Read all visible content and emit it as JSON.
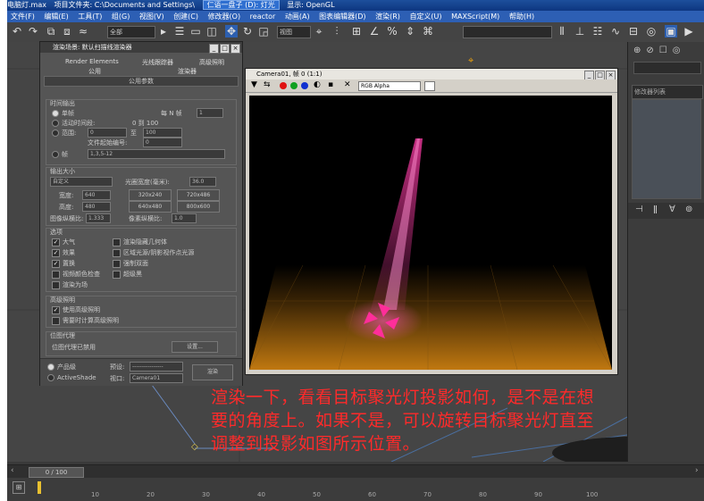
{
  "titlebar": {
    "items": [
      "电脑灯.max",
      "项目文件夹: C:\\Documents and Settings\\",
      "仁语一盘子 (D): 灯光",
      "显示: OpenGL"
    ]
  },
  "menubar": {
    "items": [
      "文件(F)",
      "编辑(E)",
      "工具(T)",
      "组(G)",
      "视图(V)",
      "创建(C)",
      "修改器(O)",
      "reactor",
      "动画(A)",
      "图表编辑器(D)",
      "渲染(R)",
      "自定义(U)",
      "MAXScript(M)",
      "帮助(H)"
    ]
  },
  "toolbar": {
    "selection_filter": "全部",
    "ref_coord": "视图"
  },
  "render_setup": {
    "title": "渲染场景: 默认扫描线渲染器",
    "tabs": [
      "Render Elements",
      "光线跟踪器",
      "高级照明",
      "公用",
      "渲染器"
    ],
    "rollout": "公用参数",
    "time_output": {
      "label": "时间输出",
      "single": "单帧",
      "every_n_label": "每 N 帧",
      "every_n_value": "1",
      "active_segment": "活动时间段:",
      "active_range": "0 到 100",
      "range": "范围:",
      "range_from": "0",
      "range_to_label": "至",
      "range_to": "100",
      "file_number_base": "文件起始编号:",
      "file_number_value": "0",
      "frames": "帧",
      "frames_value": "1,3,5-12"
    },
    "output_size": {
      "label": "输出大小",
      "preset": "自定义",
      "aperture_label": "光圈宽度(毫米):",
      "aperture_value": "36.0",
      "width_label": "宽度:",
      "width_value": "640",
      "height_label": "高度:",
      "height_value": "480",
      "presets": [
        "320x240",
        "720x486",
        "640x480",
        "800x600"
      ],
      "image_aspect_label": "图像纵横比:",
      "image_aspect_value": "1.333",
      "pixel_aspect_label": "像素纵横比:",
      "pixel_aspect_value": "1.0"
    },
    "options": {
      "label": "选项",
      "items": [
        {
          "label": "大气",
          "checked": true
        },
        {
          "label": "渲染隐藏几何体",
          "checked": false
        },
        {
          "label": "效果",
          "checked": true
        },
        {
          "label": "区域光源/阴影视作点光源",
          "checked": false
        },
        {
          "label": "置换",
          "checked": true
        },
        {
          "label": "强制双面",
          "checked": false
        },
        {
          "label": "视频颜色检查",
          "checked": false
        },
        {
          "label": "超级黑",
          "checked": false
        },
        {
          "label": "渲染为场",
          "checked": false
        }
      ]
    },
    "advanced_lighting": {
      "label": "高级照明",
      "use": "使用高级照明",
      "compute": "需要时计算高级照明"
    },
    "bitmap_proxies": {
      "label": "位图代理",
      "status": "位图代理已禁用",
      "setup": "设置..."
    },
    "bottom": {
      "production": "产品级",
      "activeshade": "ActiveShade",
      "preset_label": "预设:",
      "preset_value": "----------------",
      "viewport_label": "视口:",
      "viewport_value": "Camera01",
      "render_button": "渲染"
    }
  },
  "render_window": {
    "title": "Camera01, 帧 0 (1:1)",
    "channel": "RGB Alpha"
  },
  "right_panel": {
    "modifier_list": "修改器列表"
  },
  "caption": {
    "line1": "渲染一下，看看目标聚光灯投影如何，是不是在想",
    "line2": "要的角度上。如果不是，可以旋转目标聚光灯直至",
    "line3": "调整到投影如图所示位置。"
  },
  "timeline": {
    "slider": "0 / 100",
    "ticks": [
      "10",
      "20",
      "30",
      "40",
      "50",
      "60",
      "70",
      "80",
      "90",
      "100"
    ]
  },
  "colors": {
    "caption": "#ff2a2a",
    "light_beam": "#ff3ca8",
    "floor_glow": "#c07810",
    "titlebar": "#1d4f9c"
  }
}
